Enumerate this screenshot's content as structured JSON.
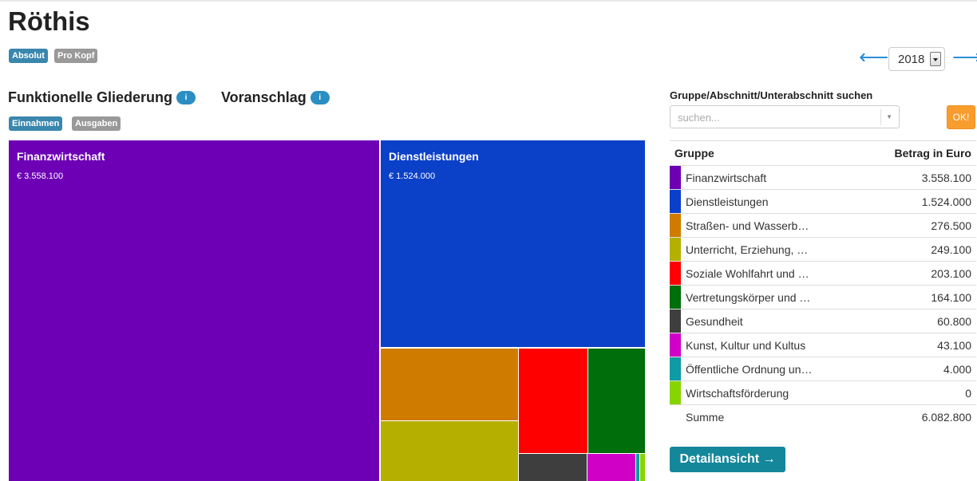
{
  "page": {
    "title": "Röthis"
  },
  "mode_labels": {
    "absolut": "Absolut",
    "pro_kopf": "Pro Kopf"
  },
  "year": {
    "value": "2018",
    "prev_arrow": "⟵",
    "next_arrow": "⟶"
  },
  "headings": {
    "funktionelle": "Funktionelle Gliederung",
    "funktionelle_badge": "i",
    "voranschlag": "Voranschlag",
    "voranschlag_badge": "i"
  },
  "type_labels": {
    "einnahmen": "Einnahmen",
    "ausgaben": "Ausgaben"
  },
  "treemap": {
    "tiles": [
      {
        "name": "Finanzwirtschaft",
        "value_label": "€ 3.558.100",
        "value": 3558100,
        "color": "#6d00b5"
      },
      {
        "name": "Dienstleistungen",
        "value_label": "€ 1.524.000",
        "value": 1524000,
        "color": "#0b40c9"
      },
      {
        "name": "",
        "value_label": "",
        "value": 276500,
        "color": "#cf7b00"
      },
      {
        "name": "",
        "value_label": "",
        "value": 249100,
        "color": "#b5b000"
      },
      {
        "name": "",
        "value_label": "",
        "value": 203100,
        "color": "#ff0000"
      },
      {
        "name": "",
        "value_label": "",
        "value": 164100,
        "color": "#006e0a"
      },
      {
        "name": "",
        "value_label": "",
        "value": 60800,
        "color": "#3e3e3e"
      },
      {
        "name": "",
        "value_label": "",
        "value": 43100,
        "color": "#d000c6"
      },
      {
        "name": "",
        "value_label": "",
        "value": 4000,
        "color": "#0e9ba3"
      },
      {
        "name": "",
        "value_label": "",
        "value": 0,
        "color": "#88d400"
      }
    ]
  },
  "search": {
    "label": "Gruppe/Abschnitt/Unterabschnitt suchen",
    "placeholder": "suchen...",
    "ok_label": "OK!"
  },
  "table": {
    "col_group": "Gruppe",
    "col_amount": "Betrag in Euro",
    "rows": [
      {
        "name": "Finanzwirtschaft",
        "amount": "3.558.100",
        "color": "#6d00b5"
      },
      {
        "name": "Dienstleistungen",
        "amount": "1.524.000",
        "color": "#0b40c9"
      },
      {
        "name": "Straßen- und Wasserb…",
        "amount": "276.500",
        "color": "#cf7b00"
      },
      {
        "name": "Unterricht, Erziehung, …",
        "amount": "249.100",
        "color": "#b5b000"
      },
      {
        "name": "Soziale Wohlfahrt und …",
        "amount": "203.100",
        "color": "#ff0000"
      },
      {
        "name": "Vertretungskörper und …",
        "amount": "164.100",
        "color": "#006e0a"
      },
      {
        "name": "Gesundheit",
        "amount": "60.800",
        "color": "#3e3e3e"
      },
      {
        "name": "Kunst, Kultur und Kultus",
        "amount": "43.100",
        "color": "#d000c6"
      },
      {
        "name": "Öffentliche Ordnung un…",
        "amount": "4.000",
        "color": "#0e9ba3"
      },
      {
        "name": "Wirtschaftsförderung",
        "amount": "0",
        "color": "#88d400"
      }
    ],
    "sum_label": "Summe",
    "sum_amount": "6.082.800"
  },
  "detail_button": "Detailansicht →"
}
